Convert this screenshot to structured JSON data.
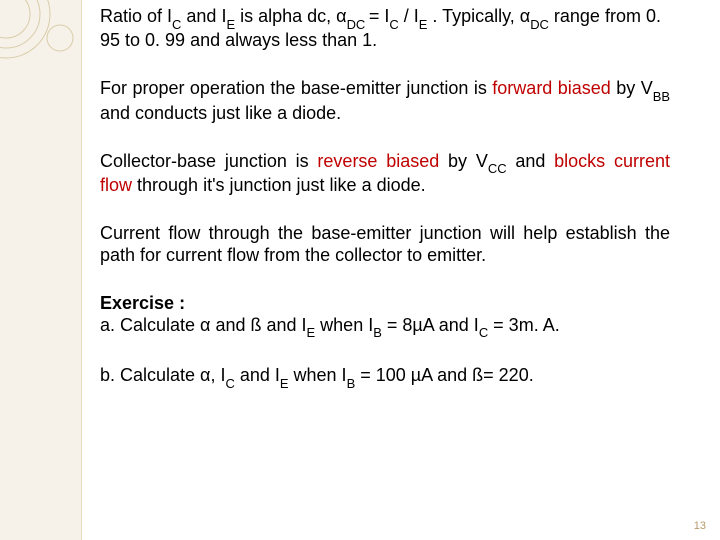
{
  "p1": {
    "a": "Ratio of I",
    "b": "C",
    "c": " and I",
    "d": "E",
    "e": " is alpha dc, α",
    "f": "DC ",
    "g": "= I",
    "h": "C",
    "i": " / I",
    "j": "E",
    "k": " . Typically, α",
    "l": "DC",
    "m": " range from 0. 95 to 0. 99 and always less than 1."
  },
  "p2": {
    "a": "For proper operation the base-emitter junction is ",
    "fw": "forward biased",
    "b": " by V",
    "c": "BB",
    "d": " and conducts just like a diode."
  },
  "p3": {
    "a": "Collector-base junction is ",
    "rv": "reverse biased",
    "b": " by V",
    "c": "CC",
    "d": " and ",
    "bl": "blocks current flow",
    "e": " through it's junction just like a diode."
  },
  "p4": "Current flow through the base-emitter junction will help establish the path for current flow from the collector to emitter.",
  "ex": {
    "title": "Exercise :",
    "a1": "a. Calculate α and ß and I",
    "a2": "E",
    "a3": " when I",
    "a4": "B",
    "a5": " = 8µA and I",
    "a6": "C",
    "a7": " = 3m. A.",
    "b1": "b. Calculate α, I",
    "b2": "C",
    "b3": " and I",
    "b4": "E",
    "b5": " when I",
    "b6": "B",
    "b7": " = 100 µA and ß= 220."
  },
  "page": "13"
}
